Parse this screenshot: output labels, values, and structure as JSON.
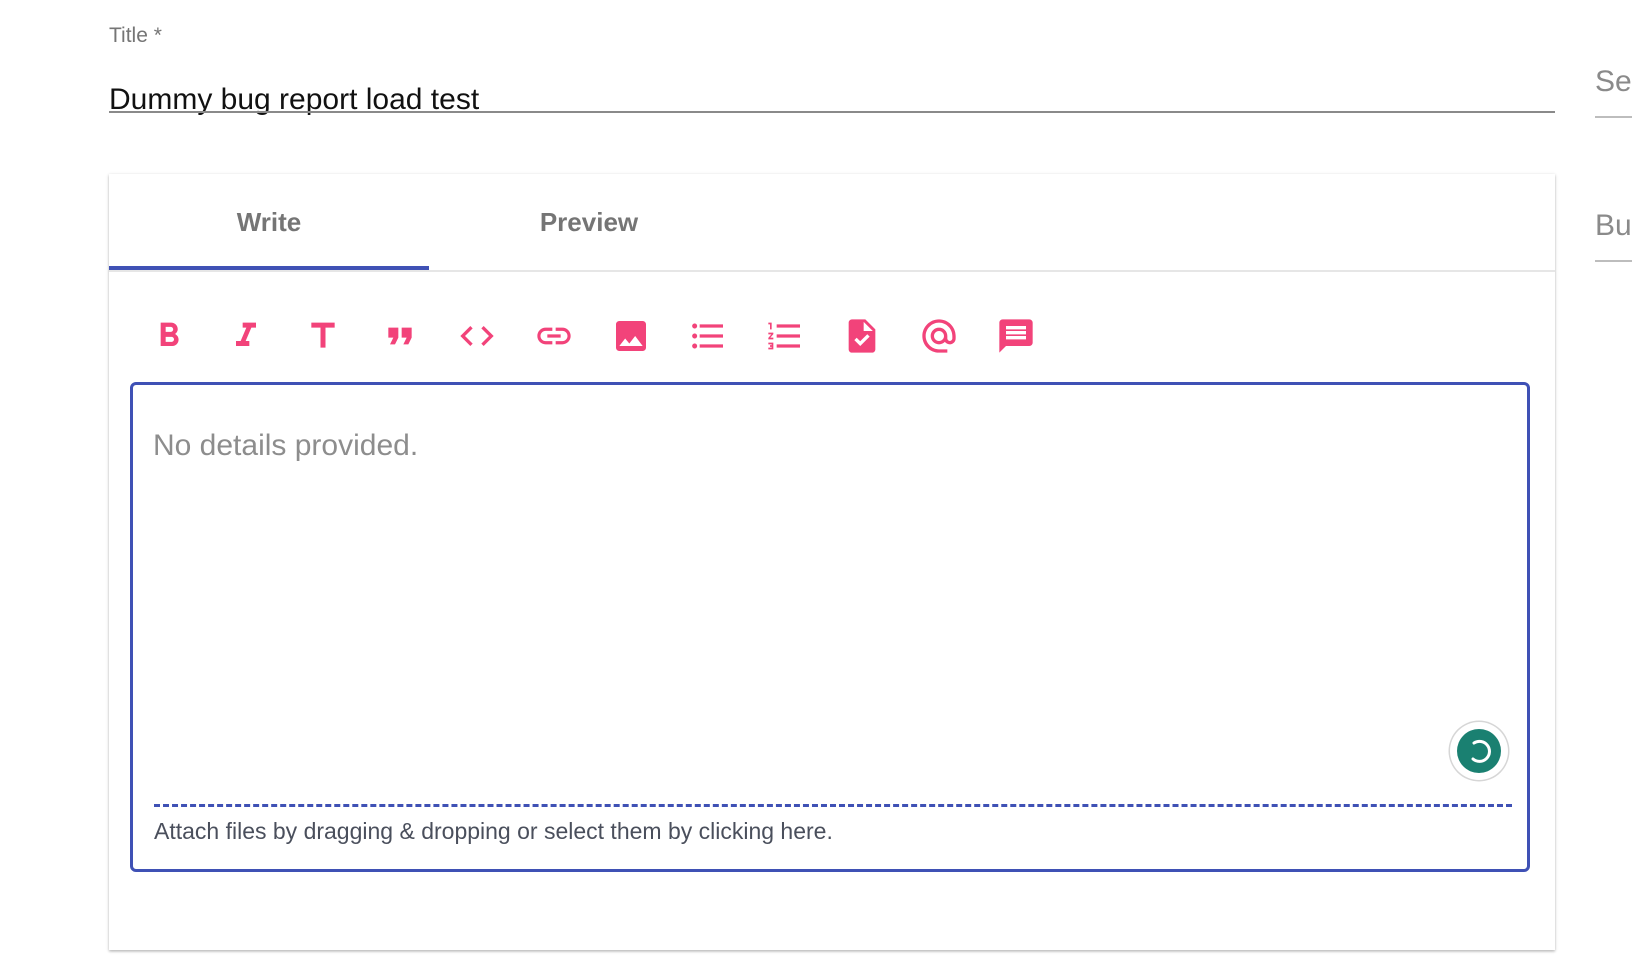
{
  "title_field": {
    "label": "Title *",
    "value": "Dummy bug report load test"
  },
  "side_fields": [
    {
      "label": "Se"
    },
    {
      "label": "Bu"
    }
  ],
  "tabs": [
    {
      "label": "Write",
      "active": true
    },
    {
      "label": "Preview",
      "active": false
    }
  ],
  "toolbar": {
    "icon_color": "#f2437a",
    "items": [
      {
        "name": "bold-icon"
      },
      {
        "name": "italic-icon"
      },
      {
        "name": "header-icon"
      },
      {
        "name": "quote-icon"
      },
      {
        "name": "code-icon"
      },
      {
        "name": "link-icon"
      },
      {
        "name": "image-icon"
      },
      {
        "name": "bulleted-list-icon"
      },
      {
        "name": "numbered-list-icon"
      },
      {
        "name": "task-list-icon"
      },
      {
        "name": "mention-icon"
      },
      {
        "name": "saved-reply-icon"
      }
    ]
  },
  "editor": {
    "placeholder": "No details provided.",
    "value": "",
    "attach_text": "Attach files by dragging & dropping or select them by clicking here.",
    "accent_color": "#3f51b5",
    "fab_color": "#1a8071"
  }
}
